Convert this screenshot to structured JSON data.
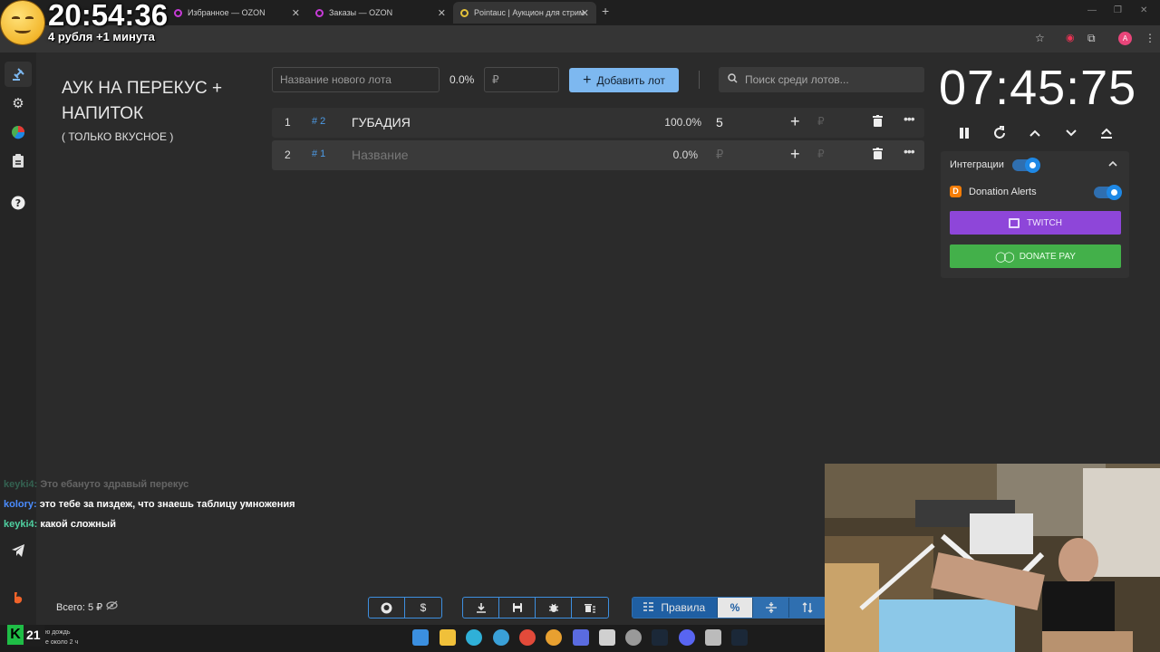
{
  "browser": {
    "tabs": [
      {
        "title": "Избранное — OZON"
      },
      {
        "title": "Заказы — OZON"
      },
      {
        "title": "Pointauc | Аукцион для стрим"
      }
    ],
    "profile_initial": "A"
  },
  "overlay": {
    "clock": "20:54:36",
    "subtitle": "4 рубля +1 минута"
  },
  "auction": {
    "title": "АУК НА ПЕРЕКУС + НАПИТОК",
    "subtitle": "( ТОЛЬКО ВКУСНОЕ )",
    "new_lot_placeholder": "Название нового лота",
    "new_lot_percent": "0.0%",
    "amount_placeholder": "₽",
    "add_lot_label": "Добавить лот",
    "search_placeholder": "Поиск среди лотов...",
    "lots": [
      {
        "index": "1",
        "id": "# 2",
        "name": "ГУБАДИЯ",
        "percent": "100.0%",
        "amount": "5",
        "amount_placeholder": "",
        "ruble": "₽"
      },
      {
        "index": "2",
        "id": "# 1",
        "name": "Название",
        "percent": "0.0%",
        "amount": "",
        "amount_placeholder": "₽",
        "ruble": "₽"
      }
    ],
    "timer": "07:45:75",
    "total": "Всего: 5 ₽"
  },
  "integrations": {
    "label": "Интеграции",
    "enabled": true,
    "donation_alerts_label": "Donation Alerts",
    "donation_alerts_enabled": true,
    "twitch_label": "TWITCH",
    "donatepay_label": "DONATE PAY",
    "colors": {
      "twitch": "#8e46d9",
      "donatepay": "#43b04a",
      "accent": "#7db8f0"
    }
  },
  "chat": [
    {
      "user": "keyki4:",
      "text": "Это ебануто здравый перекус",
      "color": "#4fd1a1",
      "faded": true
    },
    {
      "user": "kolory:",
      "text": "это тебе за пиздеж, что знаешь таблицу умножения",
      "color": "#4a8cff",
      "faded": false
    },
    {
      "user": "keyki4:",
      "text": "какой сложный",
      "color": "#4fd1a1",
      "faded": false
    }
  ],
  "bottom": {
    "rules_label": "Правила"
  },
  "taskbar": {
    "weather_badge": "K",
    "weather_temp": "21",
    "weather_line1": "ю дождь",
    "weather_line2": "е около 2 ч"
  }
}
